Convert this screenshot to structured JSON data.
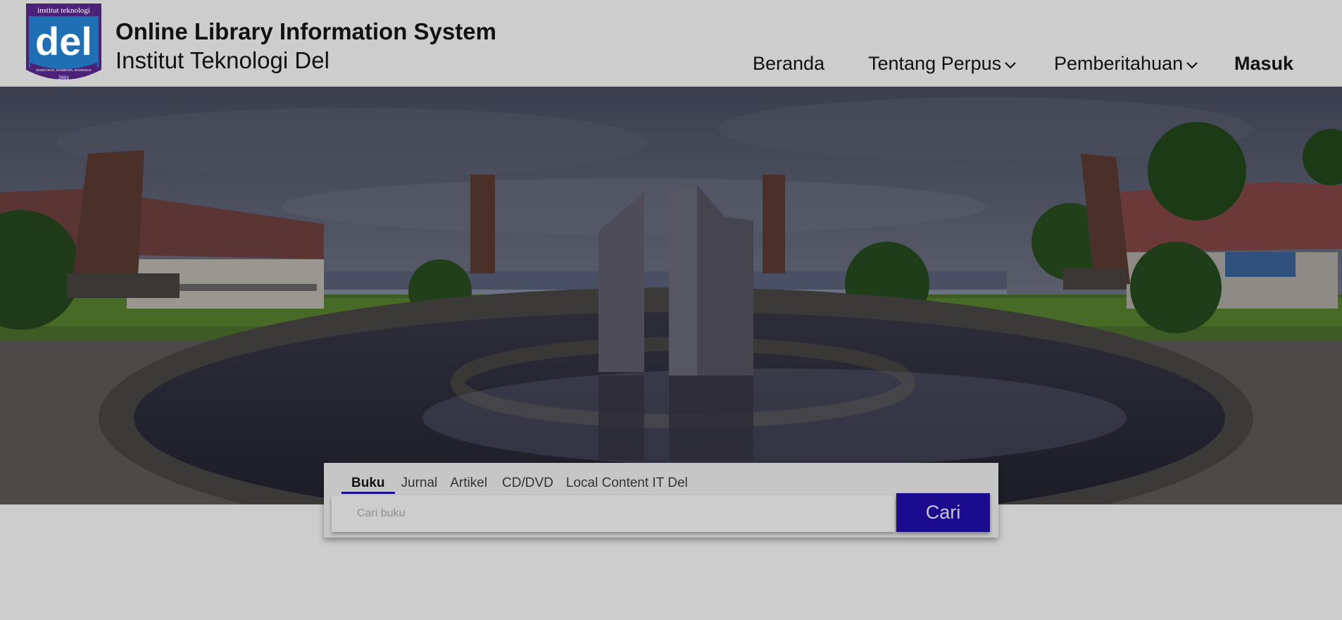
{
  "header": {
    "logo": {
      "top_text": "institut teknologi",
      "main_text": "del",
      "motto": "MARTUHAN, MARROHA, MARBISUK",
      "year": "2001"
    },
    "title": "Online Library Information System",
    "subtitle": "Institut Teknologi Del"
  },
  "nav": {
    "items": [
      {
        "label": "Beranda",
        "has_dropdown": false
      },
      {
        "label": "Tentang Perpus",
        "has_dropdown": true
      },
      {
        "label": "Pemberitahuan",
        "has_dropdown": true
      },
      {
        "label": "Masuk",
        "has_dropdown": false
      }
    ]
  },
  "search": {
    "tabs": [
      {
        "label": "Buku",
        "active": true
      },
      {
        "label": "Jurnal",
        "active": false
      },
      {
        "label": "Artikel",
        "active": false
      },
      {
        "label": "CD/DVD",
        "active": false
      },
      {
        "label": "Local Content IT Del",
        "active": false
      }
    ],
    "input": {
      "placeholder": "Cari buku",
      "value": ""
    },
    "button_label": "Cari"
  },
  "colors": {
    "page_bg": "#cdcdcd",
    "accent": "#1b0c8f",
    "logo_blue": "#1f6fb5",
    "logo_purple": "#4a2379"
  }
}
